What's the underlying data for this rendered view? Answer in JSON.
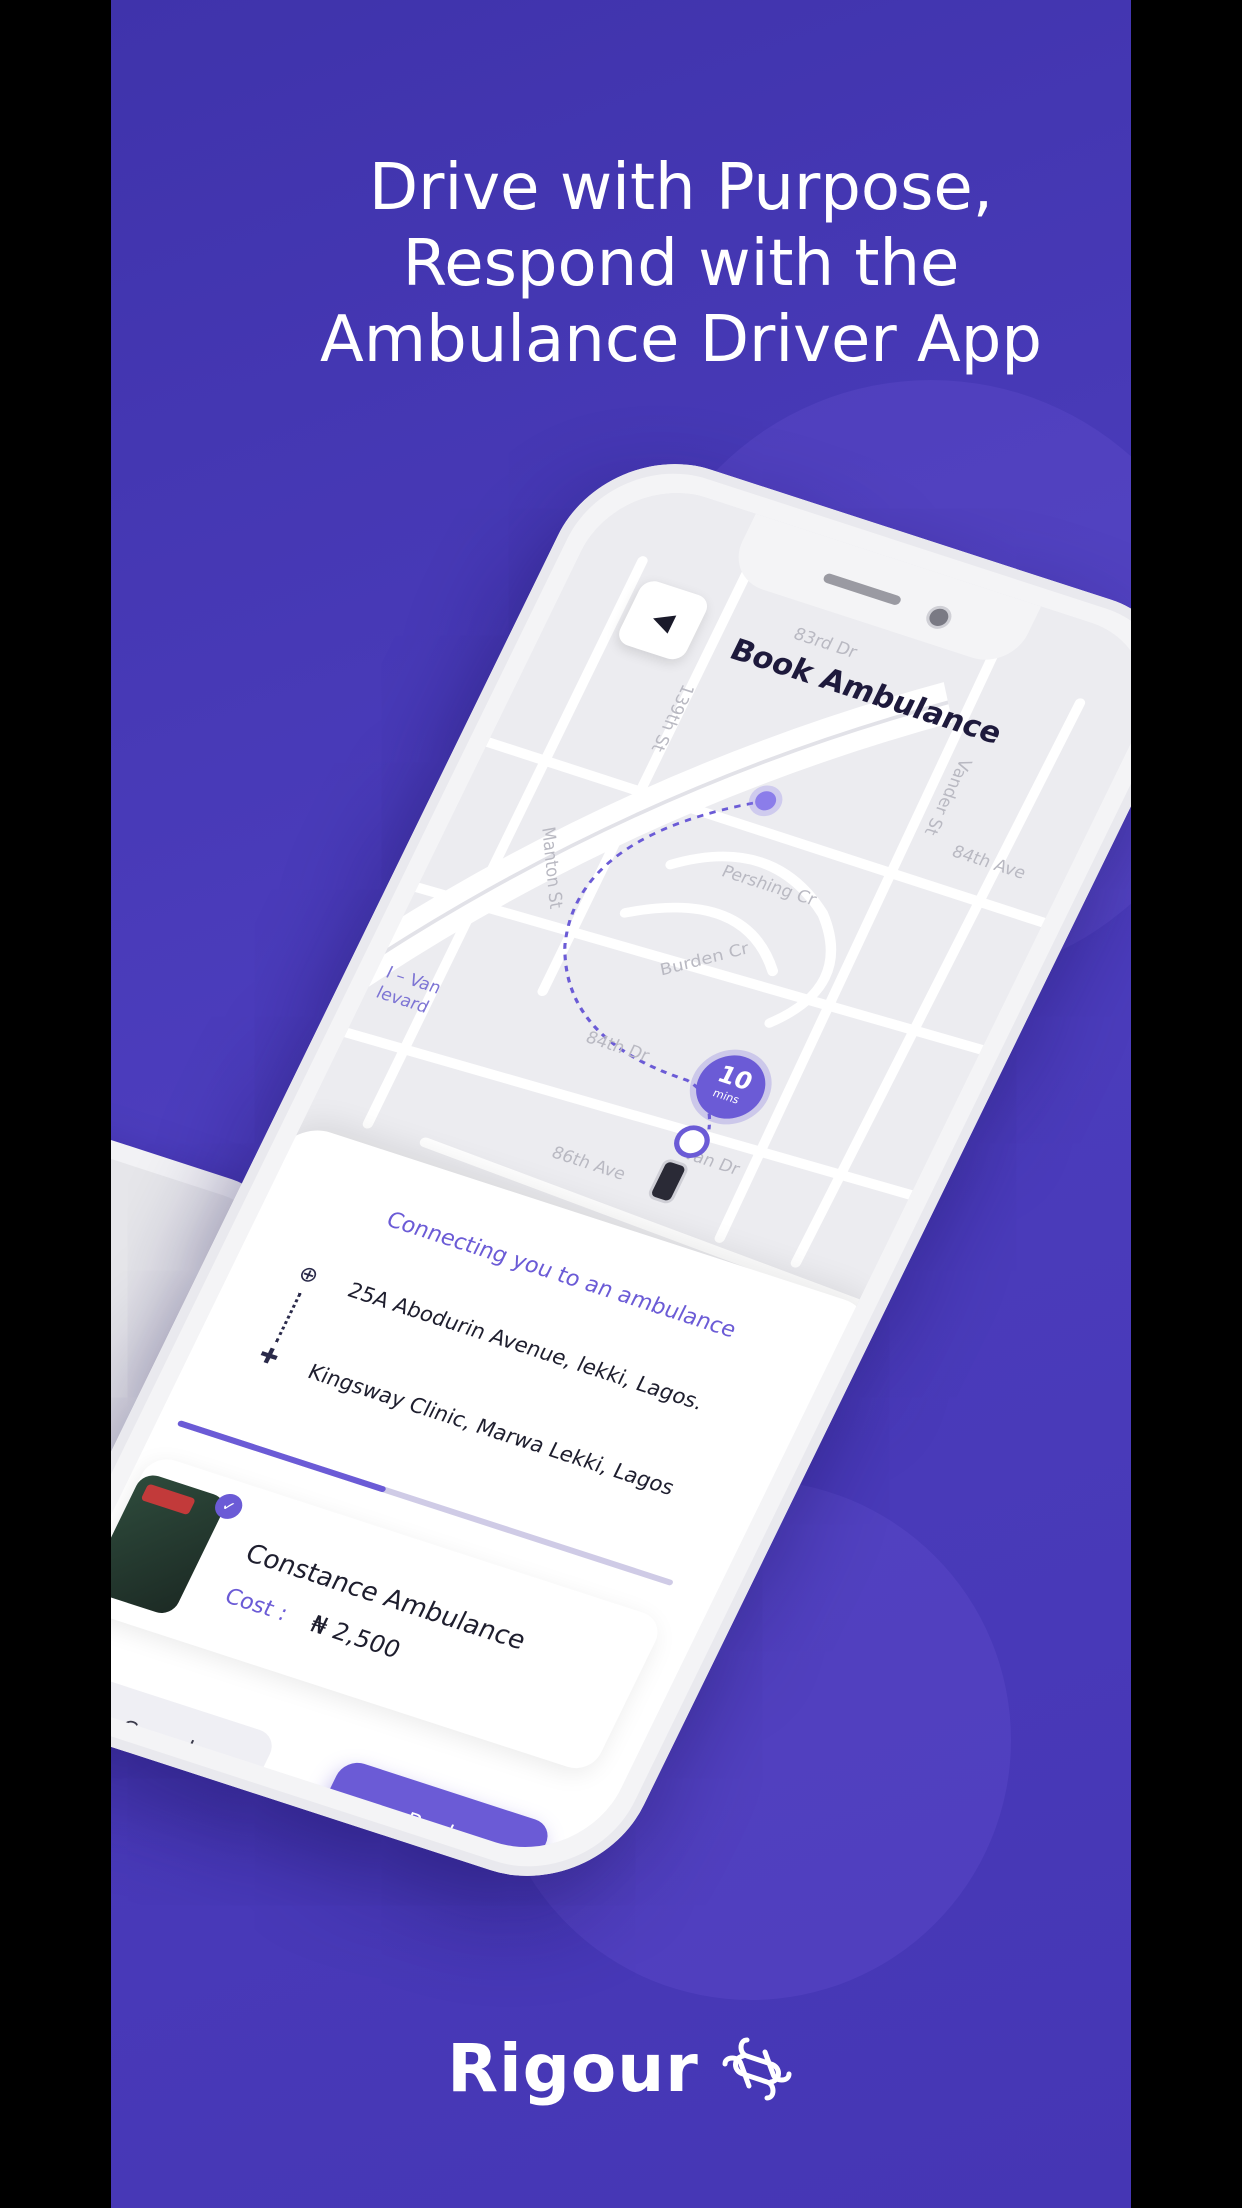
{
  "headline": {
    "line1": "Drive with Purpose,",
    "line2": "Respond with the",
    "line3": "Ambulance Driver App"
  },
  "screen": {
    "title": "Book Ambulance",
    "back_icon": "back-arrow-icon",
    "road_labels": [
      "83rd Dr",
      "139th St",
      "Manton St",
      "Pershing Cr",
      "Burden Cr",
      "84th Dr",
      "84th Ave",
      "Vander St",
      "86th Ave",
      "Van Dr",
      "I – Van",
      "levard"
    ],
    "eta": {
      "value": "10",
      "unit": "mins"
    }
  },
  "booking": {
    "status": "Connecting you to an ambulance",
    "pickup": "25A Abodurin Avenue, lekki, Lagos.",
    "destination": "Kingsway Clinic, Marwa Lekki, Lagos",
    "progress": 0.42,
    "ambulance_name": "Constance Ambulance",
    "cost_label": "Cost :",
    "cost_value": "₦ 2,500",
    "cancel_label": "Cancel",
    "book_label": "Book"
  },
  "brand": {
    "name": "Rigour"
  },
  "colors": {
    "background": "#4536b4",
    "accent": "#6b5bd6",
    "text_light": "#ffffff"
  }
}
